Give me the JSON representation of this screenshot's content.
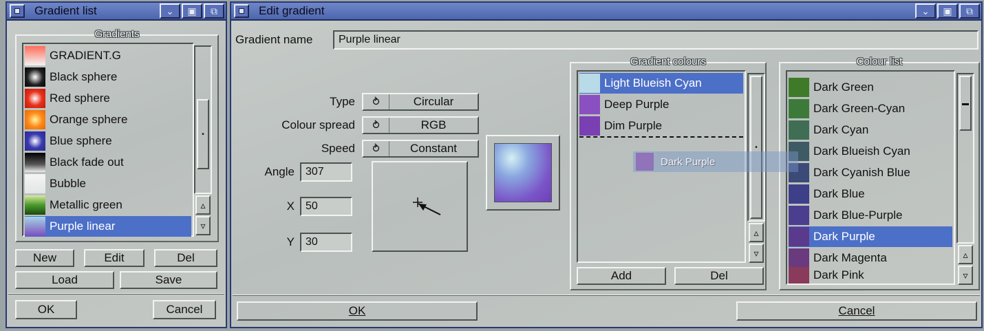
{
  "gradient_list_window": {
    "title": "Gradient list",
    "group_title": "Gradients",
    "items": [
      {
        "label": "GRADIENT.G",
        "selected": false
      },
      {
        "label": "Black sphere",
        "selected": false
      },
      {
        "label": "Red sphere",
        "selected": false
      },
      {
        "label": "Orange sphere",
        "selected": false
      },
      {
        "label": "Blue sphere",
        "selected": false
      },
      {
        "label": "Black fade out",
        "selected": false
      },
      {
        "label": "Bubble",
        "selected": false
      },
      {
        "label": "Metallic green",
        "selected": false
      },
      {
        "label": "Purple linear",
        "selected": true
      }
    ],
    "buttons": {
      "new": "New",
      "edit": "Edit",
      "del": "Del",
      "load": "Load",
      "save": "Save",
      "ok": "OK",
      "cancel": "Cancel"
    }
  },
  "edit_window": {
    "title": "Edit gradient",
    "name_label": "Gradient name",
    "name_value": "Purple linear",
    "type_label": "Type",
    "type_value": "Circular",
    "spread_label": "Colour spread",
    "spread_value": "RGB",
    "speed_label": "Speed",
    "speed_value": "Constant",
    "angle_label": "Angle",
    "angle_value": "307",
    "x_label": "X",
    "x_value": "50",
    "y_label": "Y",
    "y_value": "30",
    "gradient_colours": {
      "title": "Gradient colours",
      "items": [
        {
          "label": "Light Blueish Cyan",
          "color": "#b9dbe8",
          "selected": true
        },
        {
          "label": "Deep Purple",
          "color": "#8a4fc0",
          "selected": false
        },
        {
          "label": "Dim Purple",
          "color": "#7a3fb2",
          "selected": false
        }
      ],
      "drag_label": "Dark Purple",
      "add": "Add",
      "del": "Del"
    },
    "colour_list": {
      "title": "Colour list",
      "items": [
        {
          "label": "Dark Green",
          "color": "#3f7a28",
          "selected": false
        },
        {
          "label": "Dark Green-Cyan",
          "color": "#3d7a3a",
          "selected": false
        },
        {
          "label": "Dark Cyan",
          "color": "#3f6e55",
          "selected": false
        },
        {
          "label": "Dark Blueish Cyan",
          "color": "#3e5a64",
          "selected": false
        },
        {
          "label": "Dark Cyanish Blue",
          "color": "#3c4a78",
          "selected": false
        },
        {
          "label": "Dark Blue",
          "color": "#3d3f88",
          "selected": false
        },
        {
          "label": "Dark Blue-Purple",
          "color": "#4b3e8e",
          "selected": false
        },
        {
          "label": "Dark Purple",
          "color": "#5a3a8c",
          "selected": true
        },
        {
          "label": "Dark Magenta",
          "color": "#6a3a7e",
          "selected": false
        },
        {
          "label": "Dark Pink",
          "color": "#8a3a5a",
          "selected": false
        }
      ]
    },
    "ok": "OK",
    "cancel": "Cancel"
  },
  "accent": "#4c6fc7"
}
